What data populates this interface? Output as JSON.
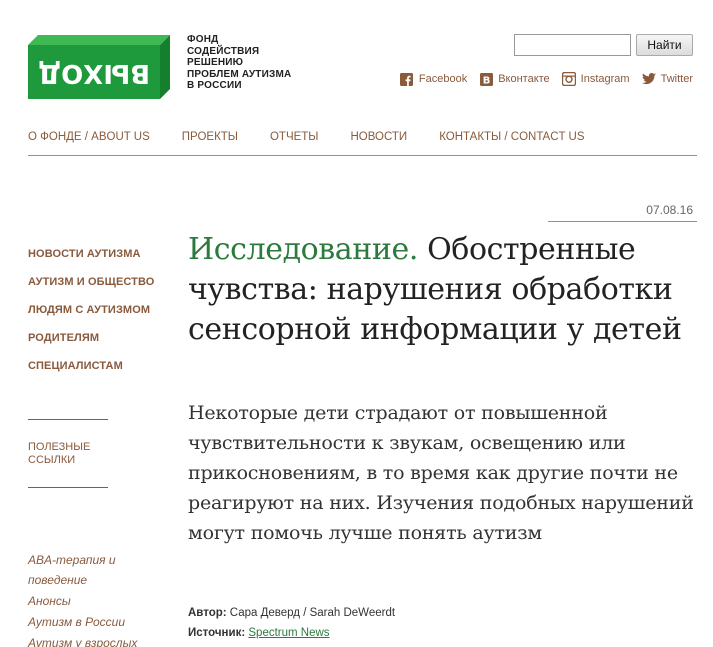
{
  "logo": {
    "word": "ВЫХОД",
    "lines": [
      "ФОНД",
      "СОДЕЙСТВИЯ",
      "РЕШЕНИЮ",
      "ПРОБЛЕМ АУТИЗМА",
      "В РОССИИ"
    ],
    "green": "#1e9a3c"
  },
  "search": {
    "value": "",
    "button": "Найти"
  },
  "social": [
    {
      "label": "Facebook",
      "icon": "facebook-icon"
    },
    {
      "label": "Вконтакте",
      "icon": "vk-icon"
    },
    {
      "label": "Instagram",
      "icon": "instagram-icon"
    },
    {
      "label": "Twitter",
      "icon": "twitter-icon"
    }
  ],
  "nav": [
    "О ФОНДЕ / ABOUT US",
    "ПРОЕКТЫ",
    "ОТЧЕТЫ",
    "НОВОСТИ",
    "КОНТАКТЫ / CONTACT US"
  ],
  "date": "07.08.16",
  "sidebar": {
    "categories": [
      "НОВОСТИ АУТИЗМА",
      "АУТИЗМ И ОБЩЕСТВО",
      "ЛЮДЯМ С АУТИЗМОМ",
      "РОДИТЕЛЯМ",
      "СПЕЦИАЛИСТАМ"
    ],
    "useful_line1": "ПОЛЕЗНЫЕ",
    "useful_line2": "ССЫЛКИ",
    "tags": [
      "ABA-терапия и поведение",
      "Анонсы",
      "Аутизм в России",
      "Аутизм у взрослых"
    ]
  },
  "article": {
    "title_prefix": "Исследование.",
    "title_rest": " Обостренные чувства: нарушения обработки сенсорной информации у детей",
    "lead": "Некоторые дети страдают от повышенной чувствительности к звукам, освещению или прикосновениям, в то время как другие почти не реагируют на них. Изучения подобных нарушений могут помочь лучше понять аутизм",
    "author_label": "Автор:",
    "author": " Сара Деверд / Sarah DeWeerdt",
    "source_label": "Источник:",
    "source": "Spectrum News"
  },
  "colors": {
    "accent_brown": "#8a5a3c",
    "title_green": "#2c7a3e"
  }
}
